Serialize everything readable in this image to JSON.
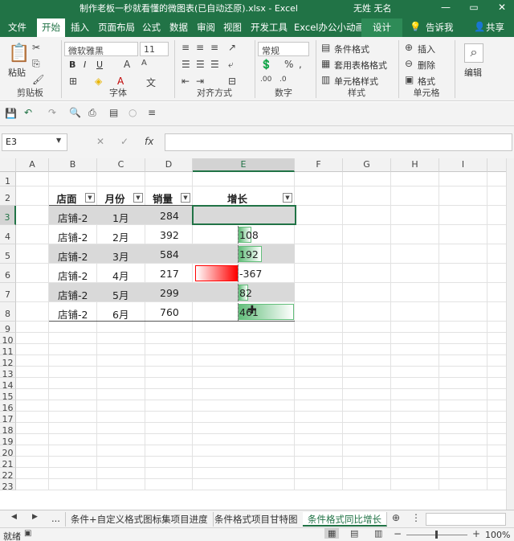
{
  "window": {
    "title": "制作老板一秒就看懂的微图表(已自动还原).xlsx  -  Excel",
    "user": "无姓 无名",
    "minimize": "—",
    "restore": "▭",
    "close": "✕"
  },
  "ribbon_tabs": [
    "文件",
    "开始",
    "插入",
    "页面布局",
    "公式",
    "数据",
    "审阅",
    "视图",
    "开发工具",
    "Excel办公小动画",
    "设计",
    "告诉我",
    "共享"
  ],
  "ribbon": {
    "clipboard": {
      "label": "剪贴板",
      "paste": "粘贴"
    },
    "font": {
      "label": "字体",
      "family": "微软雅黑",
      "size": "11",
      "bold": "B",
      "italic": "I",
      "underline": "U"
    },
    "alignment": {
      "label": "对齐方式"
    },
    "number": {
      "label": "数字",
      "format": "常规"
    },
    "styles": {
      "label": "样式",
      "conditional": "条件格式",
      "table": "套用表格格式",
      "cell": "单元格样式"
    },
    "cells": {
      "label": "单元格",
      "insert": "插入",
      "delete": "删除",
      "format": "格式"
    },
    "editing": {
      "label": "编辑"
    }
  },
  "namebox": "E3",
  "formula_icons": {
    "cancel": "✕",
    "confirm": "✓",
    "fx": "fx"
  },
  "columns": [
    "A",
    "B",
    "C",
    "D",
    "E",
    "F",
    "G",
    "H",
    "I"
  ],
  "rows": [
    "1",
    "2",
    "3",
    "4",
    "5",
    "6",
    "7",
    "8",
    "9",
    "10",
    "11",
    "12",
    "13",
    "14",
    "15",
    "16",
    "17",
    "18",
    "19",
    "20",
    "21",
    "22",
    "23"
  ],
  "table": {
    "headers": [
      "店面",
      "月份",
      "销量",
      "增长"
    ],
    "rows": [
      {
        "store": "店铺-2",
        "month": "1月",
        "sales": "284",
        "growth": "",
        "bar": 0
      },
      {
        "store": "店铺-2",
        "month": "2月",
        "sales": "392",
        "growth": "108",
        "bar": 108
      },
      {
        "store": "店铺-2",
        "month": "3月",
        "sales": "584",
        "growth": "192",
        "bar": 192
      },
      {
        "store": "店铺-2",
        "month": "4月",
        "sales": "217",
        "growth": "-367",
        "bar": -367
      },
      {
        "store": "店铺-2",
        "month": "5月",
        "sales": "299",
        "growth": "82",
        "bar": 82
      },
      {
        "store": "店铺-2",
        "month": "6月",
        "sales": "760",
        "growth": "461",
        "bar": 461
      }
    ],
    "bar_colors": {
      "positive": "#63be7b",
      "negative": "#ff0000"
    }
  },
  "sheet_tabs": [
    "...",
    "条件+自定义格式图标集项目进度",
    "条件格式项目甘特图",
    "条件格式同比增长"
  ],
  "active_sheet": "条件格式同比增长",
  "status": {
    "ready": "就绪",
    "zoom": "100%"
  },
  "colors": {
    "accent": "#217346"
  }
}
